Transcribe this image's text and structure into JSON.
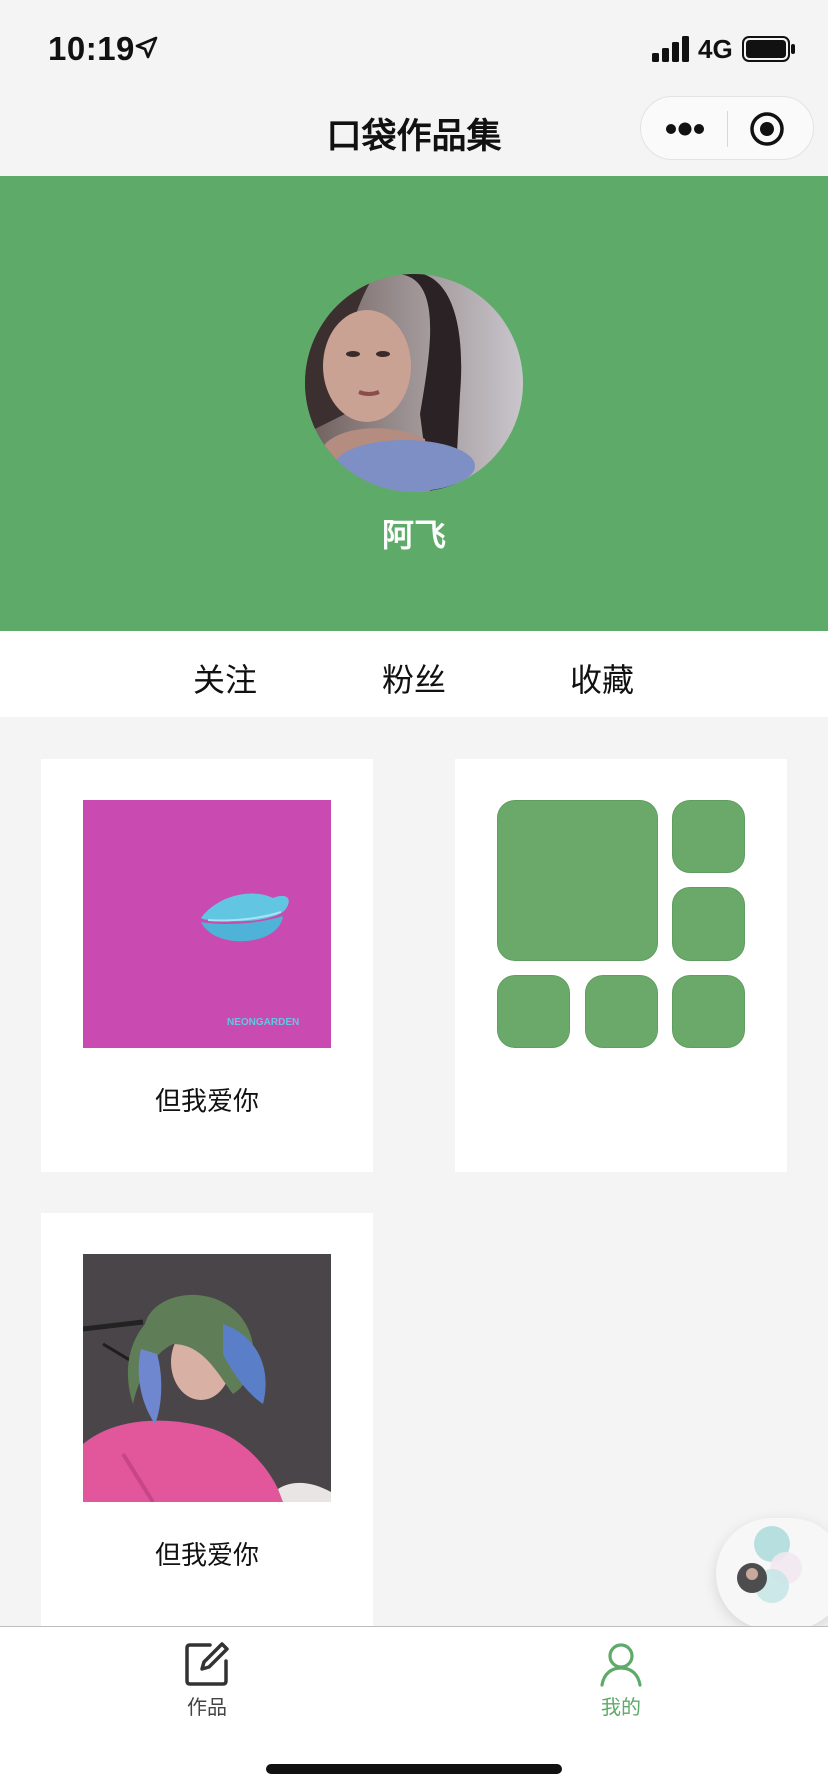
{
  "status_bar": {
    "time": "10:19",
    "network": "4G"
  },
  "nav": {
    "title": "口袋作品集"
  },
  "profile": {
    "name": "阿飞"
  },
  "tabs": [
    {
      "label": "关注"
    },
    {
      "label": "粉丝"
    },
    {
      "label": "收藏"
    }
  ],
  "works": [
    {
      "title": "但我爱你",
      "cover_text": "NEONGARDEN"
    },
    {
      "title": ""
    },
    {
      "title": "但我爱你"
    }
  ],
  "tabbar": {
    "items": [
      {
        "label": "作品"
      },
      {
        "label": "我的"
      }
    ]
  },
  "colors": {
    "header_green": "#5eaa69",
    "tile_green": "#6aa96a",
    "active_tab": "#5eaa69",
    "magenta_cover": "#c94bb1"
  }
}
